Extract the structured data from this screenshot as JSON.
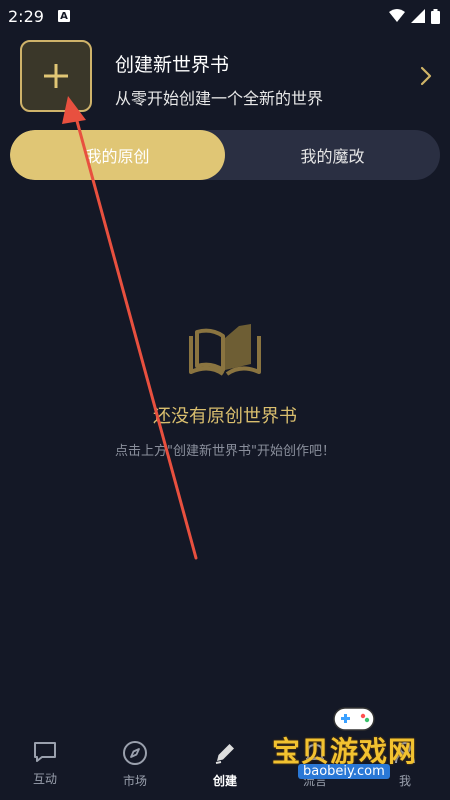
{
  "status_bar": {
    "time": "2:29",
    "notif_badge": "A"
  },
  "create_card": {
    "title": "创建新世界书",
    "subtitle": "从零开始创建一个全新的世界",
    "icon": "plus-icon",
    "chevron": "chevron-right-icon"
  },
  "tabs": {
    "original": "我的原创",
    "modded": "我的魔改",
    "active": "original"
  },
  "empty_state": {
    "title": "还没有原创世界书",
    "hint": "点击上方\"创建新世界书\"开始创作吧！",
    "icon": "open-book-icon"
  },
  "bottom_nav": {
    "items": [
      {
        "label": "互动",
        "icon": "chat-icon"
      },
      {
        "label": "市场",
        "icon": "compass-icon"
      },
      {
        "label": "创建",
        "icon": "pencil-icon"
      },
      {
        "label": "流言",
        "icon": "bell-icon"
      },
      {
        "label": "我",
        "icon": "person-icon"
      }
    ],
    "active_index": 2
  },
  "watermark": {
    "text": "宝贝游戏网",
    "url": "baobeiy.com"
  },
  "colors": {
    "accent": "#e0c675",
    "background": "#141826",
    "annotation_arrow": "#e8503f"
  }
}
